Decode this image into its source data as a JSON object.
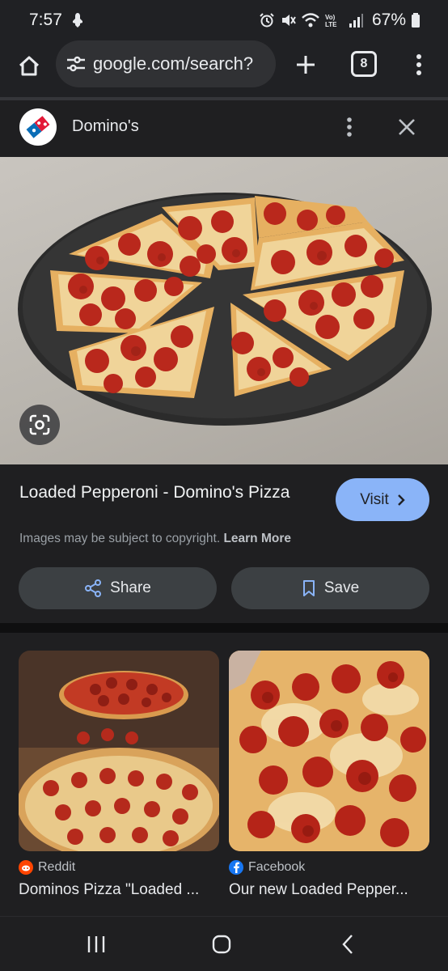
{
  "status_bar": {
    "time": "7:57",
    "battery_percent": "67%"
  },
  "browser": {
    "url": "google.com/search?",
    "tab_count": "8"
  },
  "sheet": {
    "site_name": "Domino's"
  },
  "result": {
    "title": "Loaded Pepperoni - Domino's Pizza",
    "visit_label": "Visit",
    "copyright_text": "Images may be subject to copyright.",
    "learn_more": "Learn More",
    "share_label": "Share",
    "save_label": "Save"
  },
  "related": [
    {
      "source": "Reddit",
      "caption": "Dominos Pizza \"Loaded ..."
    },
    {
      "source": "Facebook",
      "caption": "Our new Loaded Pepper..."
    }
  ],
  "colors": {
    "accent_button": "#8ab4f8",
    "background": "#1f1f21",
    "reddit": "#ff4500",
    "facebook": "#1877f2"
  }
}
